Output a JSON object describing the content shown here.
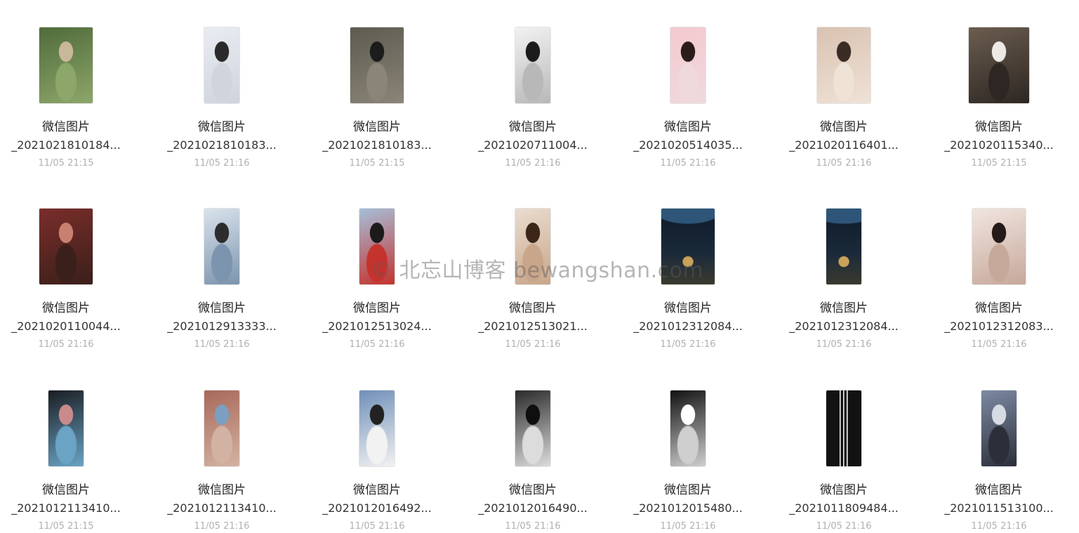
{
  "files": [
    {
      "line1": "微信图片",
      "line2": "_2021021810184...",
      "date": "11/05 21:15",
      "thumb": {
        "shape": "wide",
        "c1": "#4f6b3a",
        "c2": "#8da66a",
        "c3": "#c9b79a",
        "kind": "photo"
      }
    },
    {
      "line1": "微信图片",
      "line2": "_2021021810183...",
      "date": "11/05 21:16",
      "thumb": {
        "shape": "narrow",
        "c1": "#e9ecf2",
        "c2": "#cfd4dd",
        "c3": "#2a2a2a",
        "kind": "photo"
      }
    },
    {
      "line1": "微信图片",
      "line2": "_2021021810183...",
      "date": "11/05 21:15",
      "thumb": {
        "shape": "wide",
        "c1": "#5e5a4f",
        "c2": "#8a8578",
        "c3": "#1c1c1c",
        "kind": "photo"
      }
    },
    {
      "line1": "微信图片",
      "line2": "_2021020711004...",
      "date": "11/05 21:16",
      "thumb": {
        "shape": "narrow",
        "c1": "#f2f2f2",
        "c2": "#b8b8b8",
        "c3": "#1b1b1b",
        "kind": "photo"
      }
    },
    {
      "line1": "微信图片",
      "line2": "_2021020514035...",
      "date": "11/05 21:16",
      "thumb": {
        "shape": "narrow",
        "c1": "#f3c9cf",
        "c2": "#f0d9dc",
        "c3": "#2b1c1c",
        "kind": "photo"
      }
    },
    {
      "line1": "微信图片",
      "line2": "_2021020116401...",
      "date": "11/05 21:16",
      "thumb": {
        "shape": "wide",
        "c1": "#d9c2b1",
        "c2": "#efe2d6",
        "c3": "#3a2b25",
        "kind": "photo"
      }
    },
    {
      "line1": "微信图片",
      "line2": "_2021020115340...",
      "date": "11/05 21:15",
      "thumb": {
        "shape": "xwide",
        "c1": "#6b5d4f",
        "c2": "#2d2622",
        "c3": "#ede9e4",
        "kind": "photo"
      }
    },
    {
      "line1": "微信图片",
      "line2": "_2021020110044...",
      "date": "11/05 21:16",
      "thumb": {
        "shape": "wide",
        "c1": "#7a2d2a",
        "c2": "#3a1f1a",
        "c3": "#c9816f",
        "kind": "photo"
      }
    },
    {
      "line1": "微信图片",
      "line2": "_2021012913333...",
      "date": "11/05 21:16",
      "thumb": {
        "shape": "narrow",
        "c1": "#d9e3ec",
        "c2": "#7c94ad",
        "c3": "#2c2c2c",
        "kind": "photo"
      }
    },
    {
      "line1": "微信图片",
      "line2": "_2021012513024...",
      "date": "11/05 21:16",
      "thumb": {
        "shape": "narrow",
        "c1": "#a6bfd9",
        "c2": "#c4332e",
        "c3": "#1b1b1b",
        "kind": "photo"
      }
    },
    {
      "line1": "微信图片",
      "line2": "_2021012513021...",
      "date": "11/05 21:16",
      "thumb": {
        "shape": "narrow",
        "c1": "#e9dccf",
        "c2": "#c9a68a",
        "c3": "#3b2618",
        "kind": "photo"
      }
    },
    {
      "line1": "微信图片",
      "line2": "_2021012312084...",
      "date": "11/05 21:16",
      "thumb": {
        "shape": "wide",
        "c1": "#0e1a2a",
        "c2": "#2e5578",
        "c3": "#c9a15a",
        "kind": "space"
      }
    },
    {
      "line1": "微信图片",
      "line2": "_2021012312084...",
      "date": "11/05 21:16",
      "thumb": {
        "shape": "narrow",
        "c1": "#0e1a2a",
        "c2": "#2e5578",
        "c3": "#c9a15a",
        "kind": "space"
      }
    },
    {
      "line1": "微信图片",
      "line2": "_2021012312083...",
      "date": "11/05 21:16",
      "thumb": {
        "shape": "wide",
        "c1": "#f1e6e0",
        "c2": "#c6a89a",
        "c3": "#241a17",
        "kind": "photo"
      }
    },
    {
      "line1": "微信图片",
      "line2": "_2021012113410...",
      "date": "11/05 21:15",
      "thumb": {
        "shape": "narrow",
        "c1": "#1a1d22",
        "c2": "#6aa3c4",
        "c3": "#c98a8c",
        "kind": "photo"
      }
    },
    {
      "line1": "微信图片",
      "line2": "_2021012113410...",
      "date": "11/05 21:16",
      "thumb": {
        "shape": "narrow",
        "c1": "#a9685a",
        "c2": "#d2b3a3",
        "c3": "#7a9fc2",
        "kind": "photo"
      }
    },
    {
      "line1": "微信图片",
      "line2": "_2021012016492...",
      "date": "11/05 21:16",
      "thumb": {
        "shape": "narrow",
        "c1": "#6f8fb8",
        "c2": "#f2f2f2",
        "c3": "#222222",
        "kind": "photo"
      }
    },
    {
      "line1": "微信图片",
      "line2": "_2021012016490...",
      "date": "11/05 21:16",
      "thumb": {
        "shape": "narrow",
        "c1": "#2a2a2a",
        "c2": "#dcdcdc",
        "c3": "#0f0f0f",
        "kind": "photo"
      }
    },
    {
      "line1": "微信图片",
      "line2": "_2021012015480...",
      "date": "11/05 21:16",
      "thumb": {
        "shape": "narrow",
        "c1": "#111111",
        "c2": "#cfcfcf",
        "c3": "#ffffff",
        "kind": "photo"
      }
    },
    {
      "line1": "微信图片",
      "line2": "_2021011809484...",
      "date": "11/05 21:16",
      "thumb": {
        "shape": "narrow",
        "c1": "#121212",
        "c2": "#ffffff",
        "c3": "#121212",
        "kind": "stripes"
      }
    },
    {
      "line1": "微信图片",
      "line2": "_2021011513100...",
      "date": "11/05 21:16",
      "thumb": {
        "shape": "narrow",
        "c1": "#7e8aa3",
        "c2": "#2b2f3a",
        "c3": "#d7dbe4",
        "kind": "photo"
      }
    }
  ],
  "watermark": "© 北忘山博客 bewangshan.com"
}
